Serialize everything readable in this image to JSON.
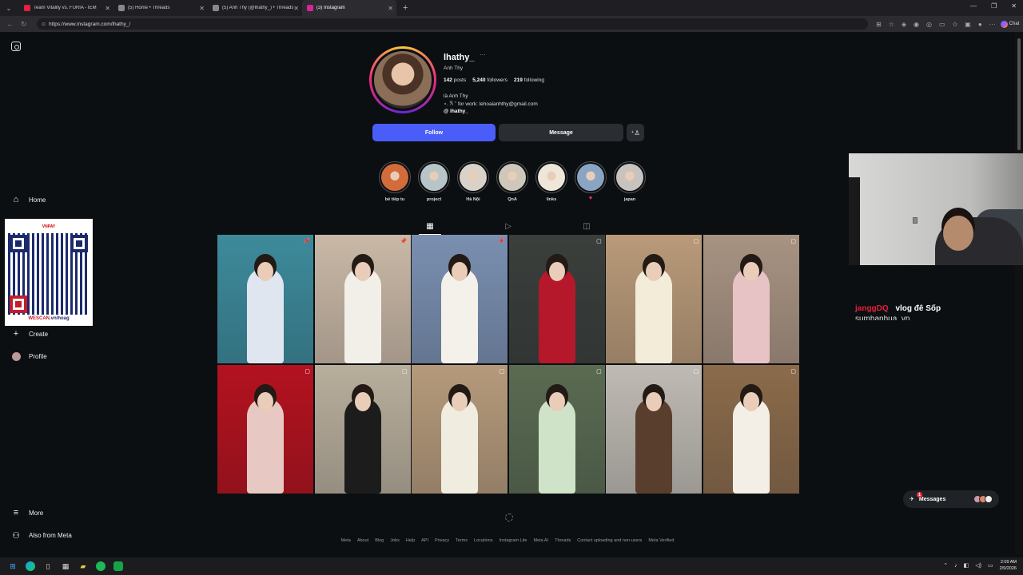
{
  "browser": {
    "tabs": [
      {
        "title": "Team Vitality vs. FURIA - IEM",
        "favicon_color": "#e3203d",
        "active": false
      },
      {
        "title": "(5) Home • Threads",
        "favicon_color": "#888888",
        "active": false
      },
      {
        "title": "(5) Anh Thy (@lhathy_) • Threads",
        "favicon_color": "#888888",
        "active": false
      },
      {
        "title": "(3) Instagram",
        "favicon_color": "#d6249f",
        "active": true
      }
    ],
    "url": "https://www.instagram.com/lhathy_/",
    "copilot_label": "Chat"
  },
  "sidebar": {
    "items": [
      {
        "label": "Home",
        "icon": "home-icon"
      },
      {
        "label": "Create",
        "icon": "plus-icon"
      },
      {
        "label": "Profile",
        "icon": "avatar-icon"
      },
      {
        "label": "More",
        "icon": "menu-icon"
      },
      {
        "label": "Also from Meta",
        "icon": "meta-icon"
      }
    ]
  },
  "qr_overlay": {
    "brand": "VNPAY",
    "caption_red": "WESCAN",
    "caption_blue": ".vn/hoag"
  },
  "profile": {
    "username": "lhathy_",
    "more": "···",
    "full_name": "Anh Thy",
    "stats": {
      "posts": "142",
      "posts_label": "posts",
      "followers": "5,240",
      "followers_label": "followers",
      "following": "219",
      "following_label": "following"
    },
    "bio_line1": "là Anh Thy",
    "bio_line2": "⋆. 𐙚 ˚ for work: lehoaianhthy@gmail.com",
    "bio_line3": "@ lhathy_",
    "follow_label": "Follow",
    "message_label": "Message",
    "suggest_icon": "add-person-icon"
  },
  "highlights": [
    {
      "label": "bé tiếp tu",
      "color": "#d36b3a"
    },
    {
      "label": "project",
      "color": "#b7c4c8"
    },
    {
      "label": "Hà Nội",
      "color": "#d9d2c8"
    },
    {
      "label": "QnA",
      "color": "#cfc7b9"
    },
    {
      "label": "links",
      "color": "#efe6da"
    },
    {
      "label": "♥",
      "color": "#8aa5c4"
    },
    {
      "label": "japan",
      "color": "#c9c3c0"
    }
  ],
  "post_tabs": [
    "posts-grid-icon",
    "reels-icon",
    "tagged-icon"
  ],
  "posts": [
    {
      "bg": "#3d8a9b",
      "fig": "#dfe6ef",
      "badge": "📌"
    },
    {
      "bg": "#c9b8a6",
      "fig": "#f2efe8",
      "badge": "📌"
    },
    {
      "bg": "#7a8fb0",
      "fig": "#f4f1ea",
      "badge": "📌"
    },
    {
      "bg": "#3a3f3c",
      "fig": "#b5182a",
      "badge": "▢"
    },
    {
      "bg": "#b99a79",
      "fig": "#f2ecd8",
      "badge": "▢"
    },
    {
      "bg": "#a89382",
      "fig": "#e7c3c6",
      "badge": "▢"
    },
    {
      "bg": "#b3121f",
      "fig": "#e8c8c2",
      "badge": "▢"
    },
    {
      "bg": "#b8ae9c",
      "fig": "#1c1c1c",
      "badge": "▢"
    },
    {
      "bg": "#b59a7b",
      "fig": "#f1ece0",
      "badge": "▢"
    },
    {
      "bg": "#5a6b52",
      "fig": "#cfe3c9",
      "badge": "▢"
    },
    {
      "bg": "#bfbab3",
      "fig": "#5a3e2d",
      "badge": "▢"
    },
    {
      "bg": "#8b6b4b",
      "fig": "#f3efe6",
      "badge": "▢"
    }
  ],
  "footer_links": [
    "Meta",
    "About",
    "Blog",
    "Jobs",
    "Help",
    "API",
    "Privacy",
    "Terms",
    "Locations",
    "Instagram Lite",
    "Meta AI",
    "Threads",
    "Contact uploading and non-users",
    "Meta Verified"
  ],
  "chat": {
    "user": "janggDQ",
    "message": "vlog đê Sốp",
    "next_line": "sumhanhua_vn"
  },
  "messages_pill": {
    "label": "Messages",
    "badge": "1"
  },
  "taskbar": {
    "time": "2:09 AM",
    "date": "2/9/2026"
  }
}
